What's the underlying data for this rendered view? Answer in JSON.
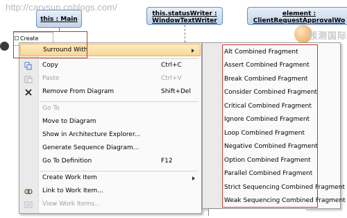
{
  "watermark": "http://carysun.cnblogs.com/",
  "diagram": {
    "lifelines": [
      {
        "line1": "this : Main",
        "line2": ""
      },
      {
        "line1": "this.statusWriter :",
        "line2": "WindowTextWriter"
      },
      {
        "line1": "element :",
        "line2": "ClientRequestApprovalWo"
      }
    ],
    "create_message": "Create Main",
    "logo_text": "领测国际"
  },
  "context_menu": {
    "items": [
      {
        "label": "Surround With",
        "shortcut": "",
        "icon": "",
        "submenu": true,
        "disabled": false,
        "highlighted": true
      },
      {
        "label": "Copy",
        "shortcut": "Ctrl+C",
        "icon": "copy-icon",
        "submenu": false,
        "disabled": false,
        "highlighted": false
      },
      {
        "label": "Paste",
        "shortcut": "Ctrl+V",
        "icon": "paste-icon",
        "submenu": false,
        "disabled": true,
        "highlighted": false
      },
      {
        "label": "Remove From Diagram",
        "shortcut": "Shift+Del",
        "icon": "remove-icon",
        "submenu": false,
        "disabled": false,
        "highlighted": false
      },
      {
        "label": "Go To",
        "shortcut": "",
        "icon": "",
        "submenu": false,
        "disabled": true,
        "highlighted": false
      },
      {
        "label": "Move to Diagram",
        "shortcut": "",
        "icon": "",
        "submenu": false,
        "disabled": false,
        "highlighted": false
      },
      {
        "label": "Show in Architecture Explorer...",
        "shortcut": "",
        "icon": "",
        "submenu": false,
        "disabled": false,
        "highlighted": false
      },
      {
        "label": "Generate Sequence Diagram...",
        "shortcut": "",
        "icon": "",
        "submenu": false,
        "disabled": false,
        "highlighted": false
      },
      {
        "label": "Go To Definition",
        "shortcut": "F12",
        "icon": "",
        "submenu": false,
        "disabled": false,
        "highlighted": false
      },
      {
        "label": "Create Work Item",
        "shortcut": "",
        "icon": "",
        "submenu": true,
        "disabled": false,
        "highlighted": false
      },
      {
        "label": "Link to Work Item...",
        "shortcut": "",
        "icon": "link-work-item-icon",
        "submenu": false,
        "disabled": false,
        "highlighted": false
      },
      {
        "label": "View Work Items...",
        "shortcut": "",
        "icon": "view-work-items-icon",
        "submenu": false,
        "disabled": true,
        "highlighted": false
      }
    ]
  },
  "surround_submenu": {
    "items": [
      "Alt Combined Fragment",
      "Assert Combined Fragment",
      "Break Combined Fragment",
      "Consider Combined Fragment",
      "Critical Combined Fragment",
      "Ignore Combined Fragment",
      "Loop Combined Fragment",
      "Negative Combined Fragment",
      "Option Combined Fragment",
      "Parallel Combined Fragment",
      "Strict Sequencing Combined Fragment",
      "Weak Sequencing Combined Fragment"
    ]
  },
  "colors": {
    "highlight_red": "#c0392b",
    "menu_highlight": "#f9d795",
    "lifeline_border": "#6b8fbf"
  }
}
